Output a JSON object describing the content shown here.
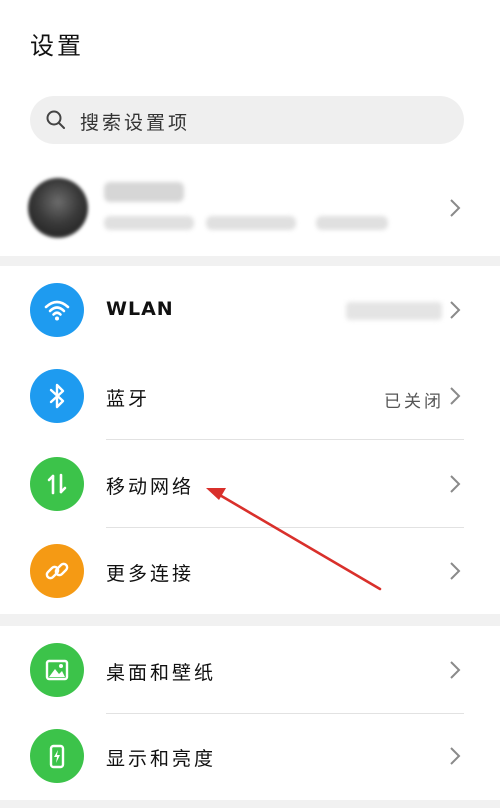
{
  "header": {
    "title": "设置"
  },
  "search": {
    "placeholder": "搜索设置项",
    "icon": "search-icon"
  },
  "account": {
    "name": "",
    "subtitle": ""
  },
  "connectivity": {
    "items": [
      {
        "label": "WLAN",
        "value": "",
        "icon": "wifi-icon",
        "color": "#1e9bf0"
      },
      {
        "label": "蓝牙",
        "value": "已关闭",
        "icon": "bluetooth-icon",
        "color": "#1e9bf0"
      },
      {
        "label": "移动网络",
        "value": "",
        "icon": "mobile-network-icon",
        "color": "#3cc34a"
      },
      {
        "label": "更多连接",
        "value": "",
        "icon": "link-icon",
        "color": "#f59a14"
      }
    ]
  },
  "display": {
    "items": [
      {
        "label": "桌面和壁纸",
        "value": "",
        "icon": "wallpaper-icon",
        "color": "#3cc34a"
      },
      {
        "label": "显示和亮度",
        "value": "",
        "icon": "brightness-icon",
        "color": "#3cc34a"
      }
    ]
  },
  "annotation": {
    "color": "#d9302b"
  }
}
